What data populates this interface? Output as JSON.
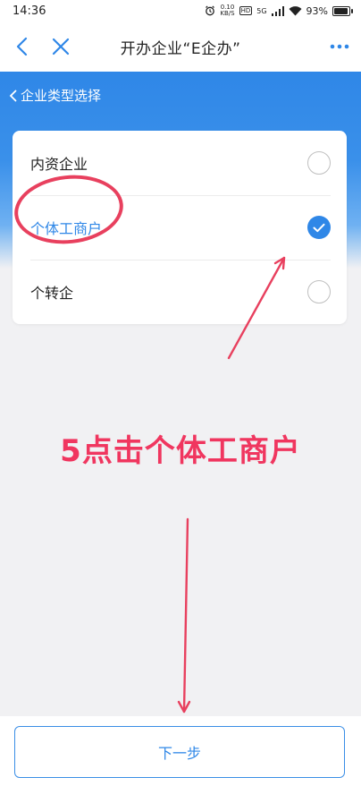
{
  "status_bar": {
    "time": "14:36",
    "speed_value": "0.10",
    "speed_unit": "KB/S",
    "hd_tag": "HD",
    "network_tag": "5G",
    "battery": "93%",
    "battery_level": 0.93
  },
  "nav": {
    "title": "开办企业“E企办”",
    "icons": [
      "back-arrow-icon",
      "close-icon",
      "more-icon"
    ]
  },
  "section": {
    "title": "企业类型选择"
  },
  "options": [
    {
      "label": "内资企业",
      "selected": false
    },
    {
      "label": "个体工商户",
      "selected": true
    },
    {
      "label": "个转企",
      "selected": false
    }
  ],
  "annotation": {
    "text": "5点击个体工商户"
  },
  "footer": {
    "next_label": "下一步"
  },
  "colors": {
    "accent": "#2f87e7",
    "annotation": "#f0365f"
  }
}
